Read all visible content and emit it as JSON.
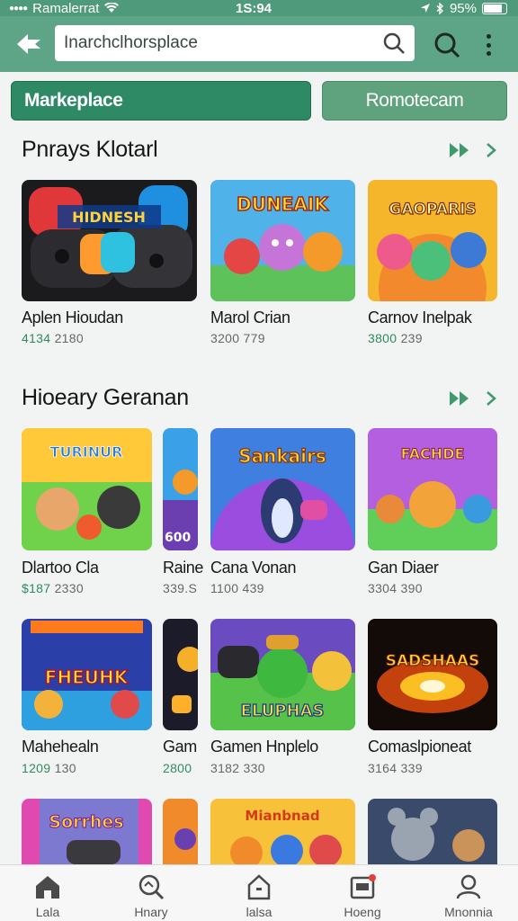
{
  "status_bar": {
    "carrier": "Ramalerrat",
    "time": "1S:94",
    "battery": "95%"
  },
  "search": {
    "value": "Inarchclhorsplace"
  },
  "segments": {
    "marketplace": "Markeplace",
    "other": "Romotecam"
  },
  "sections": [
    {
      "title": "Pnrays Klotarl",
      "cards": [
        {
          "name": "Aplen Hioudan",
          "meta_accent": "4134",
          "meta": "2180",
          "art_title": "HIDNESH"
        },
        {
          "name": "Marol Crian",
          "meta_accent": "",
          "meta": "3200 779",
          "art_title": "DUNEAIK"
        },
        {
          "name": "Carnov Inelpak",
          "meta_accent": "3800",
          "meta": "239",
          "art_title": "GAOPARIS"
        }
      ]
    },
    {
      "title": "Hioeary Geranan",
      "cards": [
        {
          "name": "Dlartoo Cla",
          "meta_accent": "$187",
          "meta": "2330",
          "art_title": "TURINUR"
        },
        {
          "name": "Raine",
          "meta_accent": "",
          "meta": "339.S",
          "art_title": "600"
        },
        {
          "name": "Cana Vonan",
          "meta_accent": "",
          "meta": "1100 439",
          "art_title": "Sankairs"
        },
        {
          "name": "Gan Diaer",
          "meta_accent": "",
          "meta": "3304 390",
          "art_title": "FACHDE"
        }
      ]
    },
    {
      "cards": [
        {
          "name": "Mahehealn",
          "meta_accent": "1209",
          "meta": "130",
          "art_title": "FHEUHK"
        },
        {
          "name": "Gam",
          "meta_accent": "2800",
          "meta": "",
          "art_title": ""
        },
        {
          "name": "Gamen Hnplelo",
          "meta_accent": "",
          "meta": "3182 330",
          "art_title": "ELUPHAS"
        },
        {
          "name": "Comaslpioneat",
          "meta_accent": "",
          "meta": "3164 339",
          "art_title": "SADSHAAS"
        }
      ]
    },
    {
      "cards": [
        {
          "art_title": "Sorrhes"
        },
        {
          "art_title": ""
        },
        {
          "art_title": "Mianbnad"
        },
        {
          "art_title": ""
        }
      ]
    }
  ],
  "bottom_nav": [
    {
      "label": "Lala",
      "icon": "home-icon"
    },
    {
      "label": "Hnary",
      "icon": "search-icon"
    },
    {
      "label": "lalsa",
      "icon": "store-icon"
    },
    {
      "label": "Hoeng",
      "icon": "inbox-icon"
    },
    {
      "label": "Mnonnia",
      "icon": "profile-icon"
    }
  ],
  "colors": {
    "header": "#5da586",
    "accent": "#2e8a64",
    "status_bar": "#4f9a7a"
  }
}
